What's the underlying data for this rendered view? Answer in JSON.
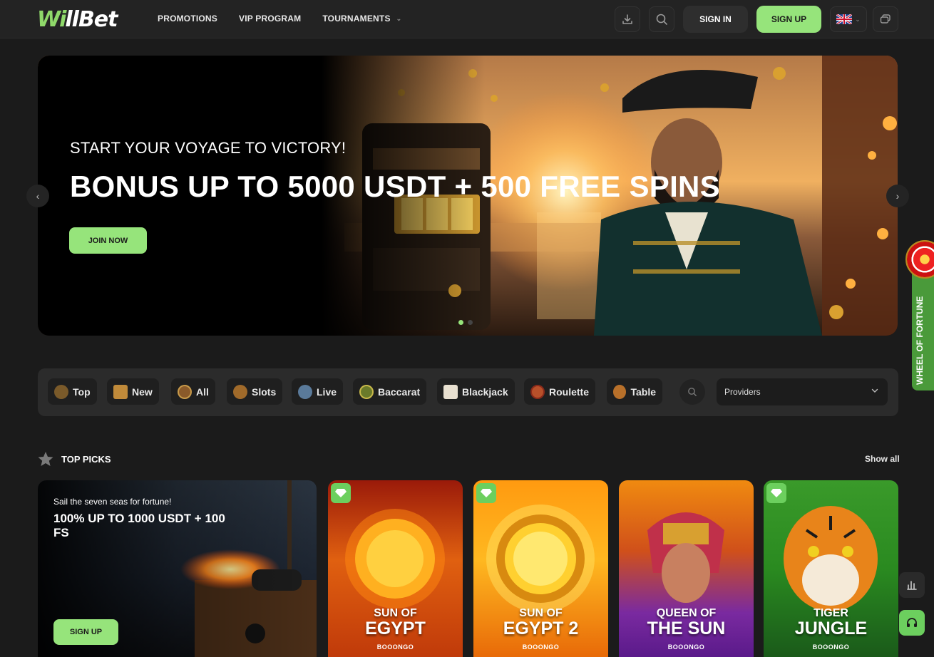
{
  "brand": {
    "logo_w": "Wi",
    "logo_rest": "llBet",
    "accent": "#96e47b"
  },
  "nav": {
    "items": [
      {
        "label": "PROMOTIONS"
      },
      {
        "label": "VIP PROGRAM"
      },
      {
        "label": "TOURNAMENTS",
        "has_dropdown": true
      }
    ]
  },
  "header": {
    "download_icon": "download-icon",
    "search_icon": "search-icon",
    "sign_in": "SIGN IN",
    "sign_up": "SIGN UP",
    "language_icon": "uk-flag-icon",
    "chat_icon": "chat-bubbles-icon"
  },
  "hero": {
    "subtitle": "START YOUR VOYAGE TO VICTORY!",
    "title": "BONUS UP TO 5000 USDT + 500 FREE SPINS",
    "cta": "JOIN NOW",
    "slide_count": 2,
    "active_slide": 1
  },
  "wheel_of_fortune": {
    "label": "WHEEL OF FORTUNE"
  },
  "categories": {
    "items": [
      {
        "label": "Top",
        "icon": "treasure-chest-icon"
      },
      {
        "label": "New",
        "icon": "new-ticket-icon"
      },
      {
        "label": "All",
        "icon": "ship-wheel-icon"
      },
      {
        "label": "Slots",
        "icon": "slot-machine-icon"
      },
      {
        "label": "Live",
        "icon": "pirate-icon"
      },
      {
        "label": "Baccarat",
        "icon": "baccarat-chip-icon"
      },
      {
        "label": "Blackjack",
        "icon": "playing-card-icon"
      },
      {
        "label": "Roulette",
        "icon": "roulette-icon"
      },
      {
        "label": "Table",
        "icon": "table-games-icon"
      }
    ],
    "providers_label": "Providers"
  },
  "top_picks": {
    "title": "TOP PICKS",
    "show_all": "Show all",
    "promo": {
      "subtitle": "Sail the seven seas for fortune!",
      "title": "100% UP TO 1000 USDT + 100 FS",
      "cta": "SIGN UP"
    },
    "games": [
      {
        "line1": "SUN OF",
        "line2": "EGYPT",
        "provider": "BOOONGO"
      },
      {
        "line1": "SUN OF",
        "line2": "EGYPT 2",
        "provider": "BOOONGO"
      },
      {
        "line1": "QUEEN OF",
        "line2": "THE SUN",
        "provider": "BOOONGO"
      },
      {
        "line1": "TIGER",
        "line2": "JUNGLE",
        "provider": "BOOONGO"
      }
    ]
  },
  "floating": {
    "stats_icon": "bar-chart-icon",
    "support_icon": "headset-icon"
  }
}
